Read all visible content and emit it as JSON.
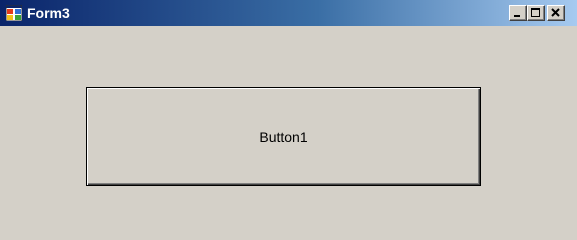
{
  "window": {
    "title": "Form3",
    "icon": "windows-form-icon",
    "controls": {
      "minimize_icon": "minimize-icon",
      "maximize_icon": "maximize-icon",
      "close_icon": "close-icon"
    }
  },
  "form": {
    "button1_label": "Button1"
  },
  "colors": {
    "face": "#d4d0c8",
    "title_gradient_start": "#0a246a",
    "title_gradient_end": "#a6caf0",
    "title_text": "#ffffff"
  }
}
